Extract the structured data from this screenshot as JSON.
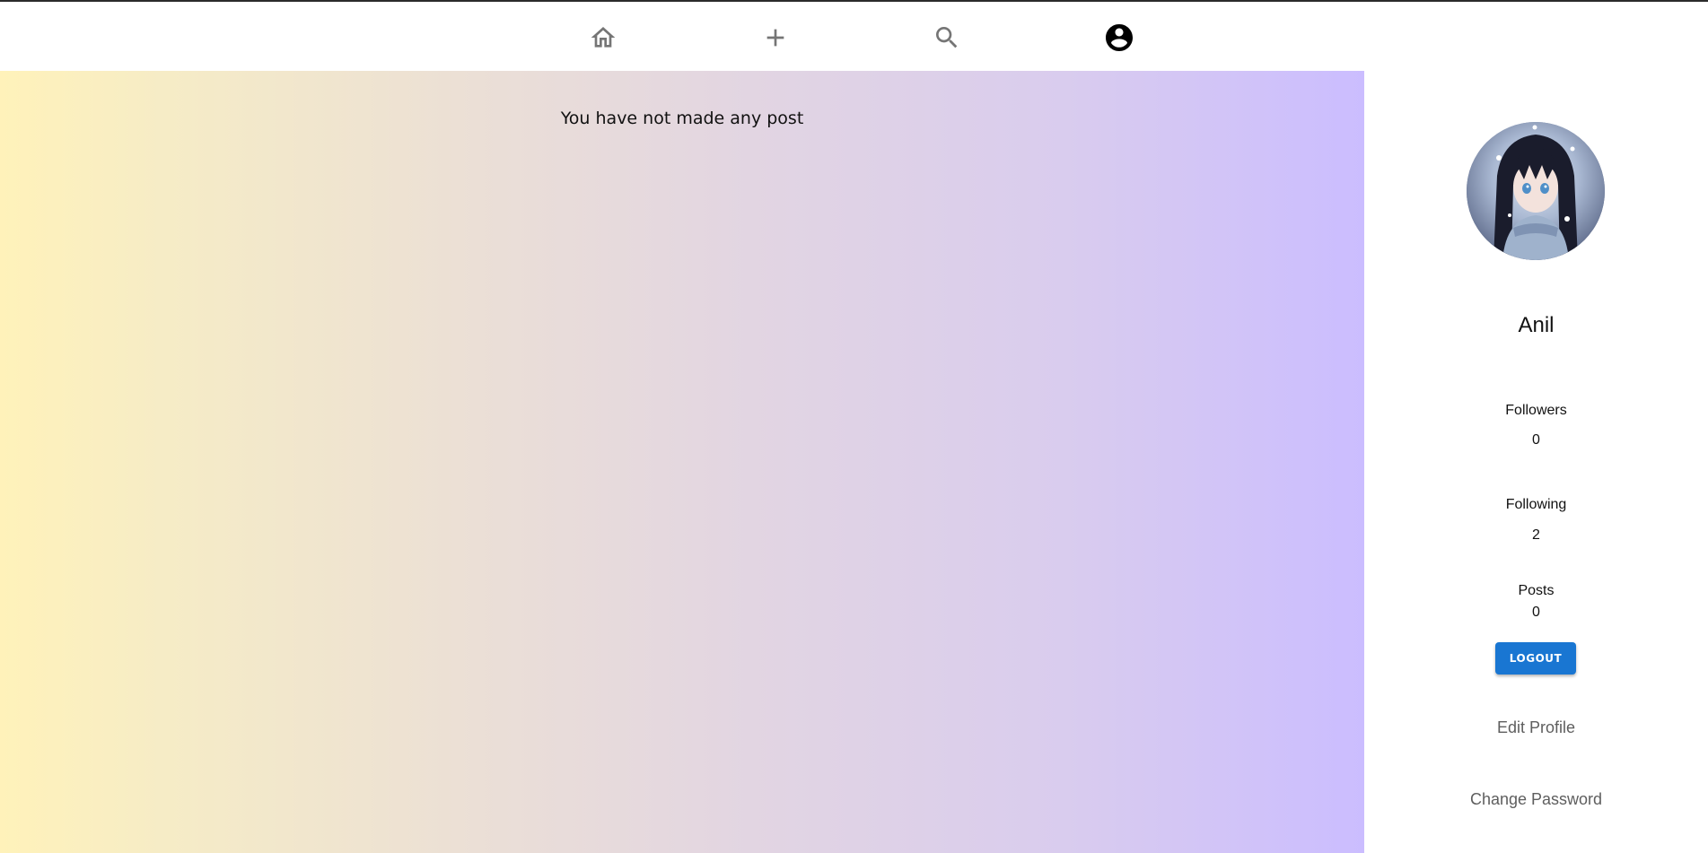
{
  "nav": {
    "items": [
      {
        "icon": "home-icon"
      },
      {
        "icon": "plus-icon"
      },
      {
        "icon": "search-icon"
      },
      {
        "icon": "account-circle-icon"
      }
    ],
    "active_index": 3
  },
  "main": {
    "empty_message": "You have not made any post",
    "gradient_start": "#fff2ba",
    "gradient_end": "#cbbdff"
  },
  "profile": {
    "name": "Anil",
    "followers_label": "Followers",
    "followers_count": "0",
    "following_label": "Following",
    "following_count": "2",
    "posts_label": "Posts",
    "posts_count": "0",
    "logout_label": "LOGOUT",
    "edit_profile_label": "Edit Profile",
    "change_password_label": "Change Password"
  },
  "colors": {
    "primary": "#1976d2",
    "icon_inactive": "#757575",
    "icon_active": "#000000"
  }
}
